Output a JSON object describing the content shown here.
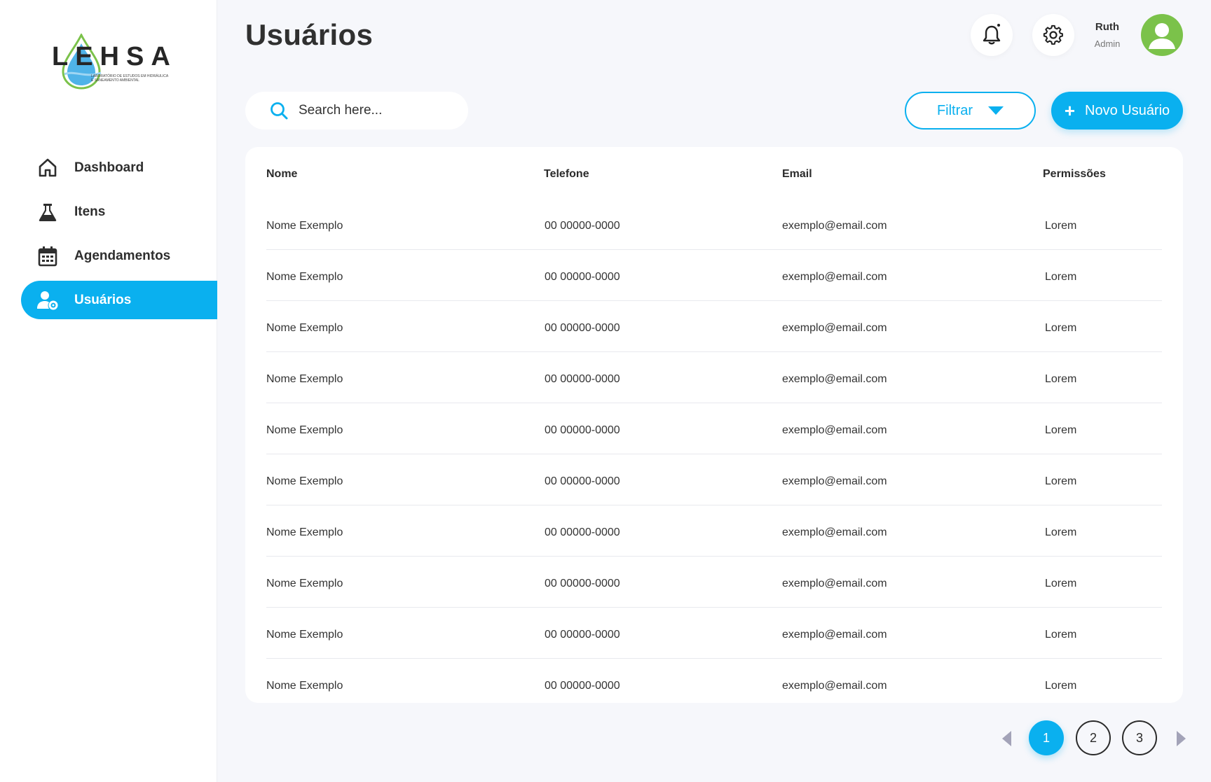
{
  "brand": {
    "logo_text": "LEHSA",
    "logo_subtitle": "LABORATÓRIO DE ESTUDOS EM HIDRÁULICA E SANEAMENTO AMBIENTAL"
  },
  "sidebar": {
    "items": [
      {
        "label": "Dashboard",
        "icon": "home-icon",
        "active": false
      },
      {
        "label": "Itens",
        "icon": "flask-icon",
        "active": false
      },
      {
        "label": "Agendamentos",
        "icon": "calendar-icon",
        "active": false
      },
      {
        "label": "Usuários",
        "icon": "user-gear-icon",
        "active": true
      }
    ]
  },
  "header": {
    "title": "Usuários",
    "user": {
      "name": "Ruth",
      "role": "Admin"
    }
  },
  "toolbar": {
    "search_placeholder": "Search here...",
    "filter_label": "Filtrar",
    "new_label": "Novo Usuário"
  },
  "table": {
    "columns": [
      "Nome",
      "Telefone",
      "Email",
      "Permissões"
    ],
    "rows": [
      [
        "Nome Exemplo",
        "00 00000-0000",
        "exemplo@email.com",
        "Lorem"
      ],
      [
        "Nome Exemplo",
        "00 00000-0000",
        "exemplo@email.com",
        "Lorem"
      ],
      [
        "Nome Exemplo",
        "00 00000-0000",
        "exemplo@email.com",
        "Lorem"
      ],
      [
        "Nome Exemplo",
        "00 00000-0000",
        "exemplo@email.com",
        "Lorem"
      ],
      [
        "Nome Exemplo",
        "00 00000-0000",
        "exemplo@email.com",
        "Lorem"
      ],
      [
        "Nome Exemplo",
        "00 00000-0000",
        "exemplo@email.com",
        "Lorem"
      ],
      [
        "Nome Exemplo",
        "00 00000-0000",
        "exemplo@email.com",
        "Lorem"
      ],
      [
        "Nome Exemplo",
        "00 00000-0000",
        "exemplo@email.com",
        "Lorem"
      ],
      [
        "Nome Exemplo",
        "00 00000-0000",
        "exemplo@email.com",
        "Lorem"
      ],
      [
        "Nome Exemplo",
        "00 00000-0000",
        "exemplo@email.com",
        "Lorem"
      ]
    ]
  },
  "pagination": {
    "pages": [
      "1",
      "2",
      "3"
    ],
    "current": "1"
  },
  "colors": {
    "accent": "#0ab0ef",
    "avatar_bg": "#7bc24a",
    "background": "#f6f7fb"
  }
}
